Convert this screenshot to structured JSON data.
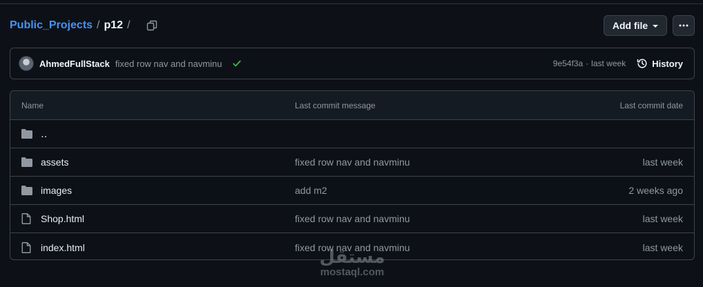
{
  "breadcrumb": {
    "repo": "Public_Projects",
    "separator": "/",
    "current": "p12"
  },
  "actions": {
    "add_file_label": "Add file",
    "more_label": "···"
  },
  "commit": {
    "author": "AhmedFullStack",
    "message": "fixed row nav and navminu",
    "status": "success",
    "hash": "9e54f3a",
    "separator": "·",
    "time": "last week",
    "history_label": "History"
  },
  "table": {
    "headers": {
      "name": "Name",
      "message": "Last commit message",
      "date": "Last commit date"
    },
    "parent_label": "‥",
    "rows": [
      {
        "type": "folder",
        "name": "assets",
        "message": "fixed row nav and navminu",
        "date": "last week"
      },
      {
        "type": "folder",
        "name": "images",
        "message": "add m2",
        "date": "2 weeks ago"
      },
      {
        "type": "file",
        "name": "Shop.html",
        "message": "fixed row nav and navminu",
        "date": "last week"
      },
      {
        "type": "file",
        "name": "index.html",
        "message": "fixed row nav and navminu",
        "date": "last week"
      }
    ]
  },
  "watermark": {
    "arabic": "مستقل",
    "latin": "mostaql.com"
  },
  "colors": {
    "background": "#0d1117",
    "link": "#4493f8",
    "border": "#3d444d",
    "success": "#3fb950",
    "muted": "#9198a1"
  },
  "icons": {
    "copy": "copy-icon",
    "check": "check-icon",
    "history": "history-icon",
    "folder": "folder-icon",
    "file": "file-icon",
    "caret": "triangle-down-icon",
    "kebab": "kebab-horizontal-icon"
  }
}
